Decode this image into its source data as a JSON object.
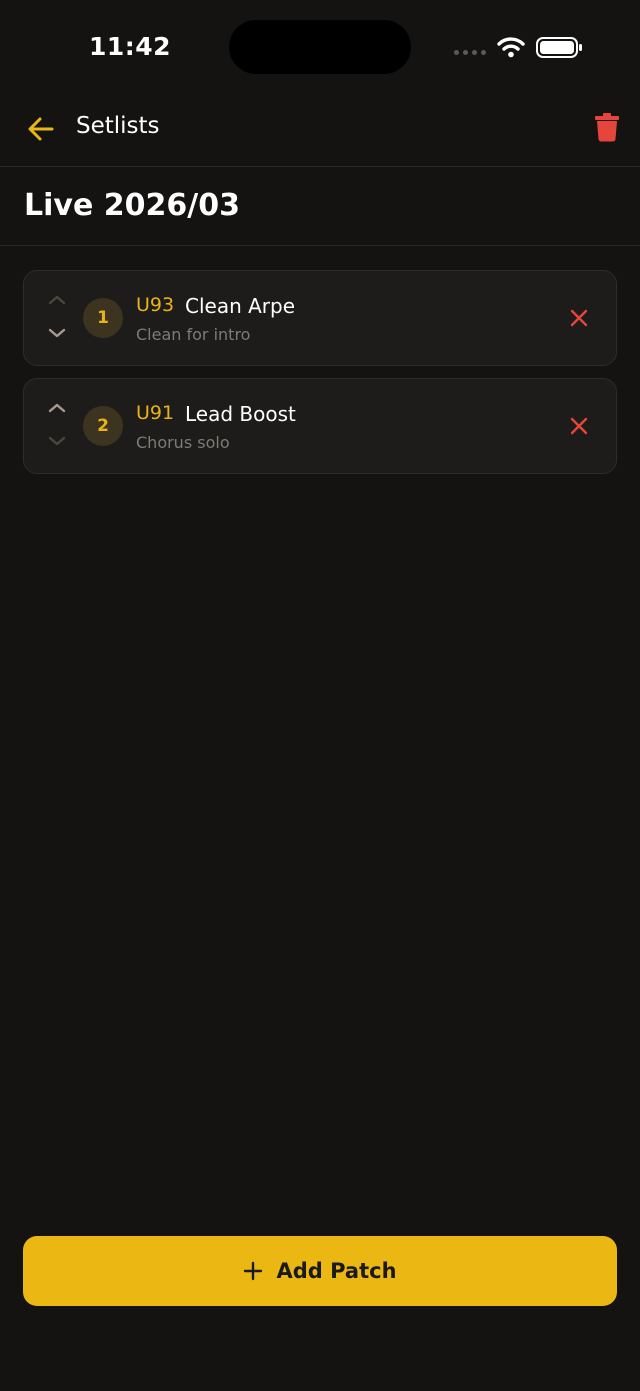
{
  "status_bar": {
    "time": "11:42"
  },
  "header": {
    "title": "Setlists",
    "back_icon": "arrow-left-icon",
    "delete_icon": "trash-icon"
  },
  "setlist": {
    "title": "Live 2026/03"
  },
  "patches": [
    {
      "number": "1",
      "code": "U93",
      "name": "Clean Arpe",
      "note": "Clean for intro"
    },
    {
      "number": "2",
      "code": "U91",
      "name": "Lead Boost",
      "note": "Chorus solo"
    }
  ],
  "footer": {
    "add_label": "Add Patch"
  },
  "colors": {
    "accent": "#ebb713",
    "danger": "#e5463b",
    "background": "#141312",
    "card": "#1e1c1a"
  }
}
